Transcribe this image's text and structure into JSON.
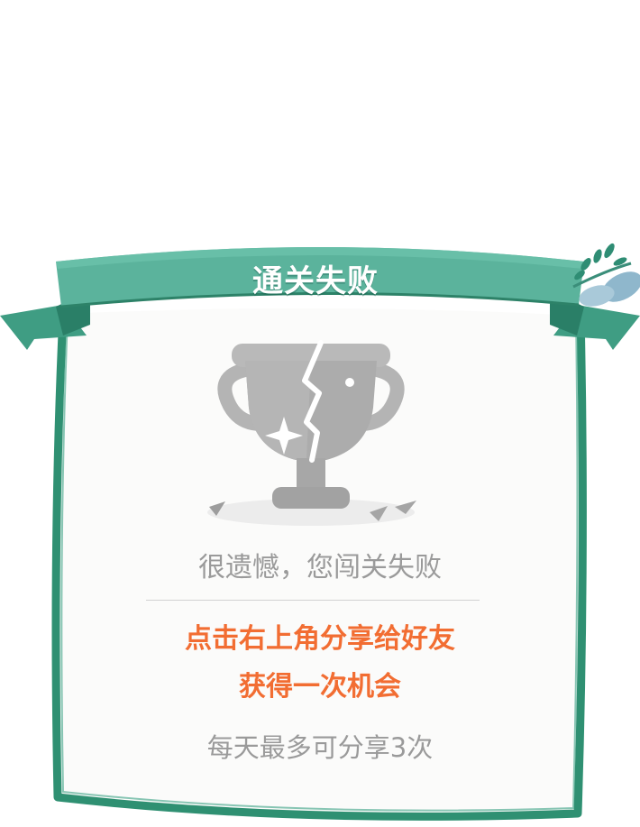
{
  "dialog": {
    "title": "通关失败",
    "message": "很遗憾，您闯关失败",
    "cta_line1": "点击右上角分享给好友",
    "cta_line2": "获得一次机会",
    "note": "每天最多可分享3次"
  },
  "icons": {
    "trophy": "broken-trophy-icon",
    "leaf": "leaf-branch-icon"
  },
  "colors": {
    "frame": "#2f9072",
    "banner": "#5bb39c",
    "background": "#fbfbfa",
    "accent": "#f26d32",
    "muted_text": "#9a9a9a",
    "trophy": "#a9a9a9"
  }
}
